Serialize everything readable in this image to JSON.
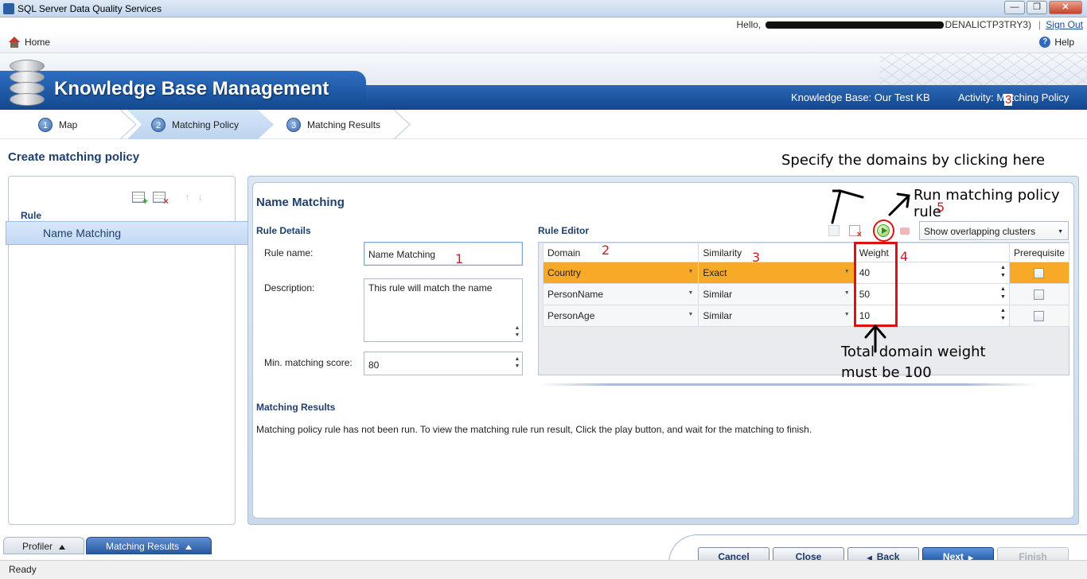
{
  "window": {
    "title": "SQL Server Data Quality Services",
    "buttons": [
      "—",
      "❐",
      "✕"
    ]
  },
  "user": {
    "greeting": "Hello,",
    "server_suffix": "DENALICTP3TRY3)",
    "separator": "|",
    "sign_out": "Sign Out"
  },
  "nav": {
    "home": "Home",
    "help": "Help",
    "help_glyph": "?"
  },
  "banner": {
    "title": "Knowledge Base Management",
    "knowledge_base": "Knowledge Base: Our Test KB",
    "activity": "Activity: Matching Policy"
  },
  "steps": [
    {
      "num": "1",
      "label": "Map"
    },
    {
      "num": "2",
      "label": "Matching Policy"
    },
    {
      "num": "3",
      "label": "Matching Results"
    }
  ],
  "page": {
    "title": "Create matching policy"
  },
  "rules_panel": {
    "header": "Rule",
    "items": [
      "Name Matching"
    ],
    "up_arrow": "↑",
    "down_arrow": "↓"
  },
  "main": {
    "title": "Name Matching",
    "rule_details": {
      "heading": "Rule Details",
      "rule_name_label": "Rule name:",
      "rule_name_value": "Name Matching",
      "description_label": "Description:",
      "description_value": "This rule will match the name",
      "min_score_label": "Min. matching score:",
      "min_score_value": "80"
    },
    "rule_editor": {
      "heading": "Rule Editor",
      "cluster_option": "Show overlapping clusters",
      "columns": [
        "Domain",
        "Similarity",
        "Weight",
        "Prerequisite"
      ],
      "rows": [
        {
          "domain": "Country",
          "similarity": "Exact",
          "weight": "40",
          "prerequisite": false
        },
        {
          "domain": "PersonName",
          "similarity": "Similar",
          "weight": "50",
          "prerequisite": false
        },
        {
          "domain": "PersonAge",
          "similarity": "Similar",
          "weight": "10",
          "prerequisite": false
        }
      ]
    },
    "matching_results": {
      "heading": "Matching Results",
      "message": "Matching policy rule has not been run. To view the matching rule run result, Click the play button, and wait for the matching to finish."
    }
  },
  "annotations": {
    "specify_domains": "Specify the domains by clicking here",
    "run_rule": "Run matching policy rule",
    "total_weight_line1": "Total domain weight",
    "total_weight_line2": "must be 100",
    "n1": "1",
    "n2": "2",
    "n3": "3",
    "n4": "4",
    "n5": "5"
  },
  "bottom_tabs": {
    "profiler": "Profiler",
    "matching_results": "Matching Results"
  },
  "buttons": {
    "cancel": "Cancel",
    "close": "Close",
    "back": "Back",
    "next": "Next",
    "finish": "Finish"
  },
  "status": "Ready",
  "colors": {
    "accent": "#1f3f6b",
    "selected_row": "#f7a928",
    "banner": "#12468c",
    "annotation": "#c0202a"
  }
}
